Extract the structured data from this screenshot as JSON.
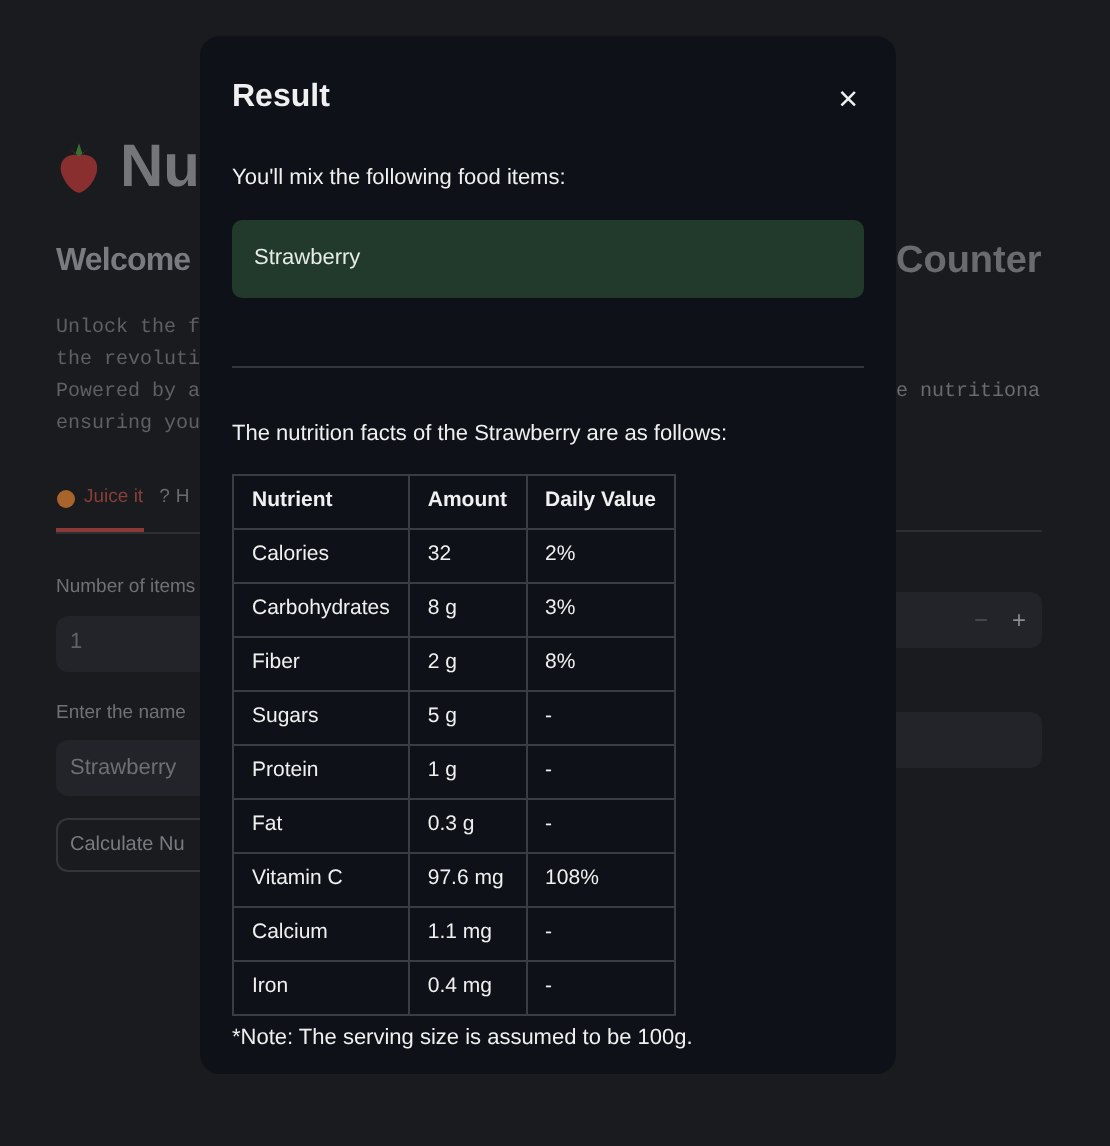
{
  "page": {
    "title": "Nu",
    "subtitle_left": "Welcome",
    "subtitle_right": "Counter",
    "intro_left": [
      "Unlock the f",
      "the revoluti",
      "Powered by a",
      "ensuring you"
    ],
    "intro_right": "e nutritiona",
    "tabs": [
      {
        "kind": "fruit",
        "label": "Juice it",
        "selected": true
      },
      {
        "kind": "help",
        "icon": "?",
        "label": "H",
        "selected": false
      }
    ],
    "count_label": "Number of items",
    "count_value": "1",
    "stepper": [
      "−",
      "+"
    ],
    "name_label": "Enter the name",
    "name_value": "Strawberry",
    "button": "Calculate Nu"
  },
  "dialog": {
    "title": "Result",
    "close": "×",
    "intro": "You'll mix the following food items:",
    "items": [
      "Strawberry"
    ],
    "facts_intro": "The nutrition facts of the Strawberry are as follows:",
    "table": {
      "columns": [
        "Nutrient",
        "Amount",
        "Daily Value"
      ],
      "rows": [
        [
          "Calories",
          "32",
          "2%"
        ],
        [
          "Carbohydrates",
          "8 g",
          "3%"
        ],
        [
          "Fiber",
          "2 g",
          "8%"
        ],
        [
          "Sugars",
          "5 g",
          "-"
        ],
        [
          "Protein",
          "1 g",
          "-"
        ],
        [
          "Fat",
          "0.3 g",
          "-"
        ],
        [
          "Vitamin C",
          "97.6 mg",
          "108%"
        ],
        [
          "Calcium",
          "1.1 mg",
          "-"
        ],
        [
          "Iron",
          "0.4 mg",
          "-"
        ]
      ]
    },
    "note": "*Note: The serving size is assumed to be 100g."
  }
}
